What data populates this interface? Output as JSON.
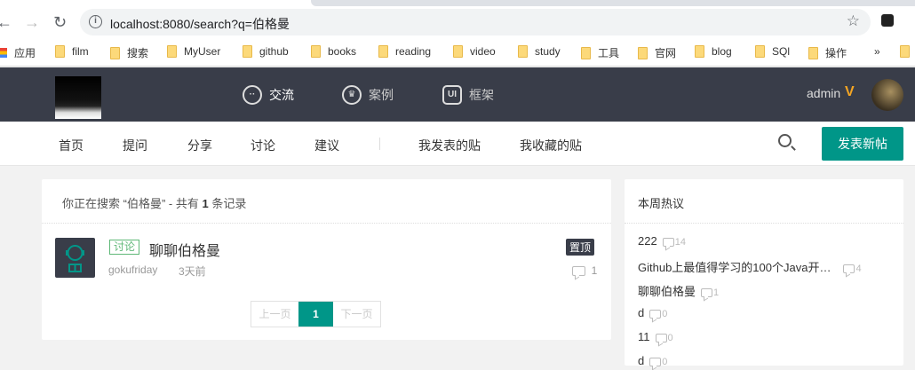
{
  "browser": {
    "url": "localhost:8080/search?q=伯格曼",
    "bookmarks": [
      "应用",
      "film",
      "搜索",
      "MyUser",
      "github",
      "books",
      "reading",
      "video",
      "study",
      "工具",
      "官网",
      "blog",
      "SQl",
      "操作"
    ],
    "more": "»"
  },
  "header": {
    "nav": [
      {
        "label": "交流",
        "icon": "chat-icon"
      },
      {
        "label": "案例",
        "icon": "crown-icon"
      },
      {
        "label": "框架",
        "icon": "ui-icon"
      }
    ],
    "user": "admin",
    "vip_badge": "V"
  },
  "subnav": {
    "items": [
      "首页",
      "提问",
      "分享",
      "讨论",
      "建议"
    ],
    "mine": [
      "我发表的贴",
      "我收藏的贴"
    ],
    "post_button": "发表新帖"
  },
  "search": {
    "prefix": "你正在搜索 “",
    "query": "伯格曼",
    "middle": "” - 共有 ",
    "count": "1",
    "suffix": " 条记录"
  },
  "results": [
    {
      "tag": "讨论",
      "title": "聊聊伯格曼",
      "author": "gokufriday",
      "time": "3天前",
      "badge": "置顶",
      "comments": "1"
    }
  ],
  "pager": {
    "prev": "上一页",
    "current": "1",
    "next": "下一页"
  },
  "hot": {
    "title": "本周热议",
    "items": [
      {
        "title": "222",
        "count": "14"
      },
      {
        "title": "Github上最值得学习的100个Java开…",
        "count": "4"
      },
      {
        "title": "聊聊伯格曼",
        "count": "1"
      },
      {
        "title": "d",
        "count": "0"
      },
      {
        "title": "11",
        "count": "0"
      },
      {
        "title": "d",
        "count": "0"
      }
    ]
  },
  "colors": {
    "header": "#393d49",
    "accent": "#009688",
    "tag": "#5fb878"
  }
}
